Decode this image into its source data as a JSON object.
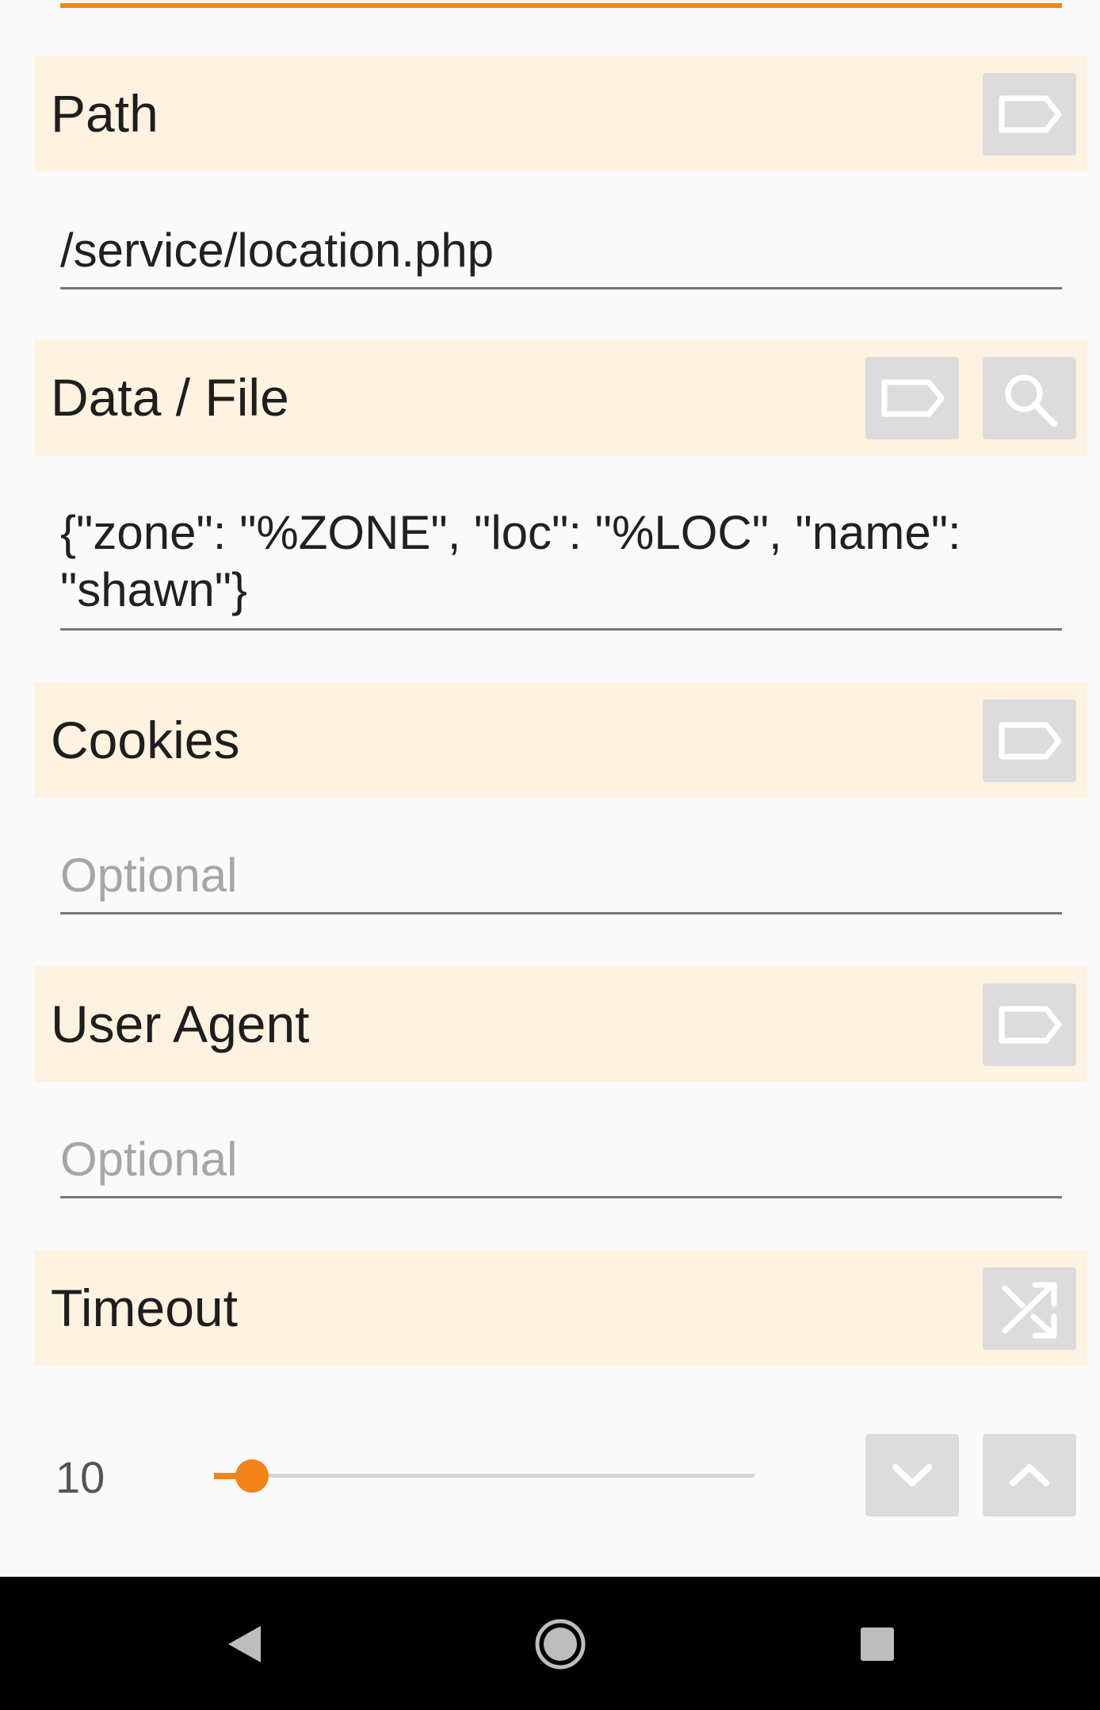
{
  "sections": {
    "path": {
      "title": "Path",
      "value": "/service/location.php"
    },
    "data_file": {
      "title": "Data / File",
      "value": "{\"zone\": \"%ZONE\", \"loc\": \"%LOC\", \"name\":",
      "value_line2": "\"shawn\"}"
    },
    "cookies": {
      "title": "Cookies",
      "placeholder": "Optional"
    },
    "user_agent": {
      "title": "User Agent",
      "placeholder": "Optional"
    },
    "timeout": {
      "title": "Timeout",
      "value": "10",
      "slider_fraction": 0.07
    }
  },
  "icons": {
    "tag": "label-tag-icon",
    "search": "search-icon",
    "shuffle": "shuffle-icon",
    "down": "chevron-down-icon",
    "up": "chevron-up-icon",
    "back": "nav-back-icon",
    "home": "nav-home-icon",
    "recents": "nav-recents-icon"
  },
  "colors": {
    "accent": "#f28418",
    "header_bg": "#fef2e0",
    "button_bg": "#dcdcdc"
  }
}
